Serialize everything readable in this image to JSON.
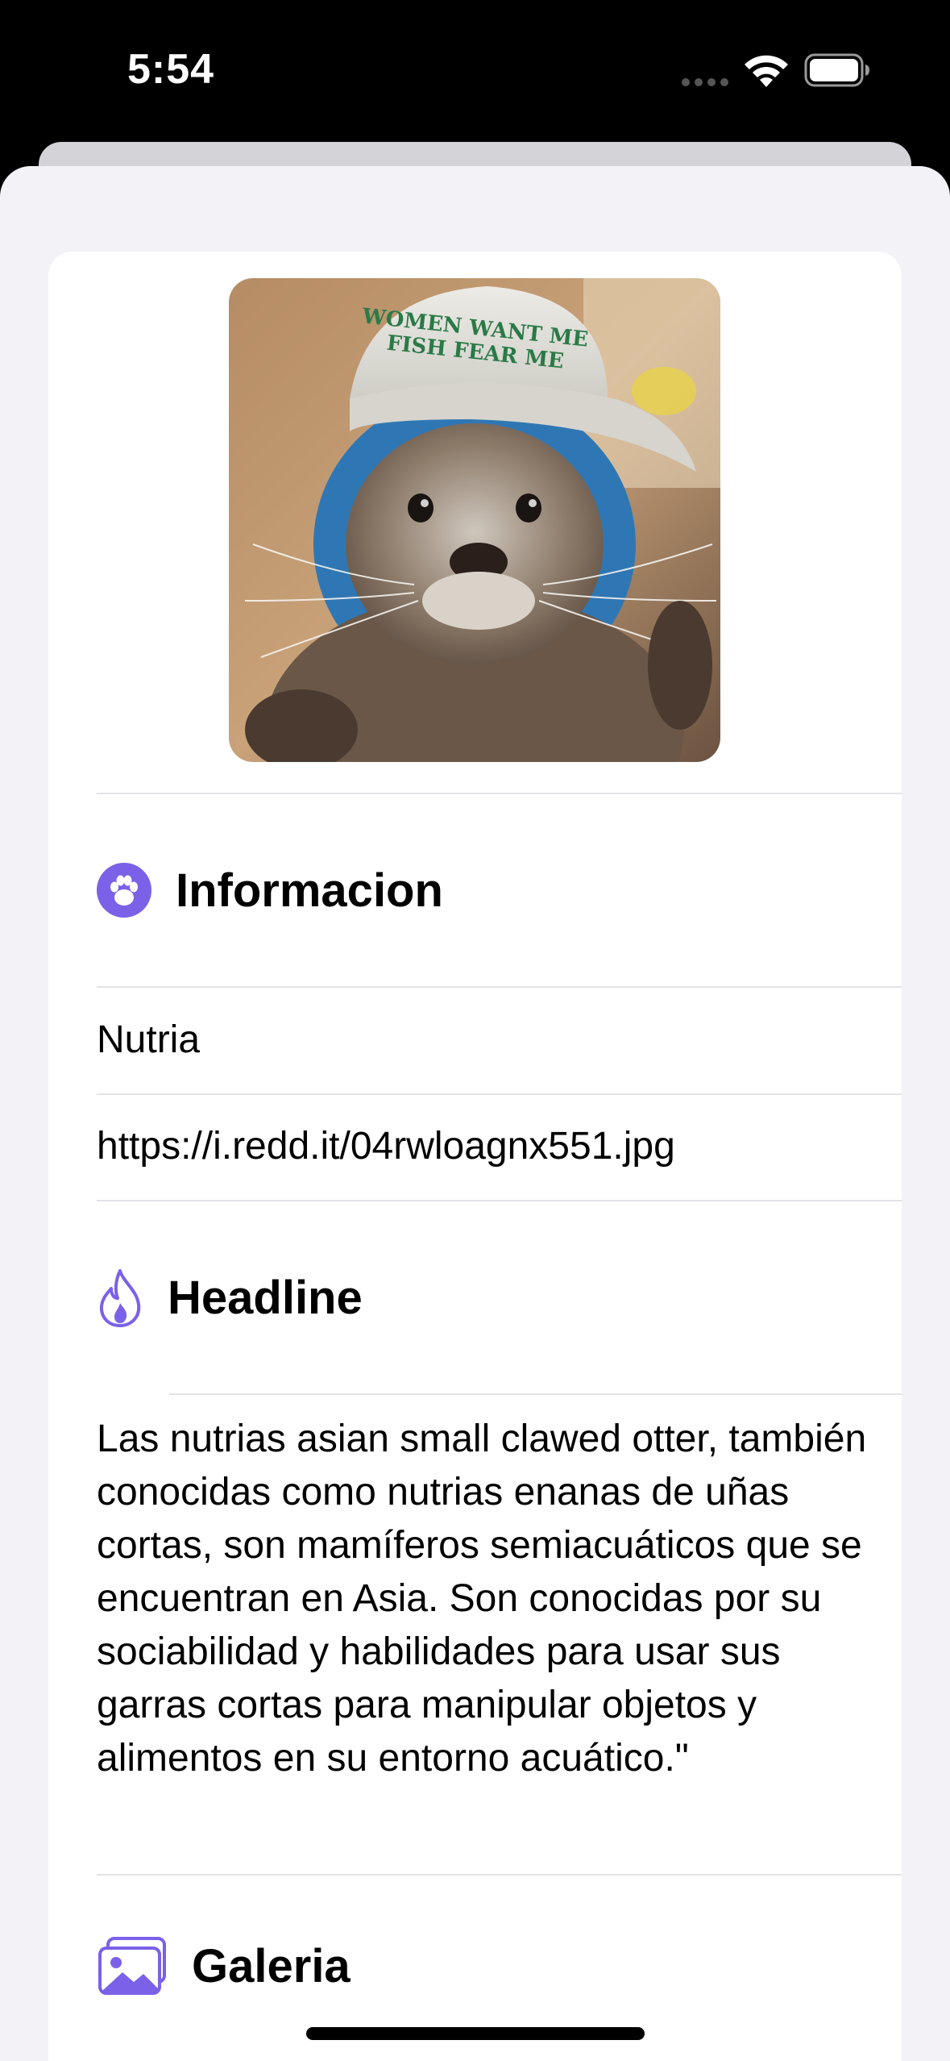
{
  "status_bar": {
    "time": "5:54"
  },
  "profile": {
    "image_alt": "Otter wearing a cap",
    "cap_text_line1": "WOMEN WANT ME",
    "cap_text_line2": "FISH FEAR ME"
  },
  "sections": {
    "informacion": {
      "title": "Informacion",
      "icon": "paw-icon",
      "name": "Nutria",
      "url": "https://i.redd.it/04rwloagnx551.jpg"
    },
    "headline": {
      "title": "Headline",
      "icon": "flame-icon",
      "text": "Las nutrias asian small clawed otter, también conocidas como nutrias enanas de uñas cortas, son mamíferos semiacuáticos que se encuentran en Asia. Son conocidas por su sociabilidad y habilidades para usar sus garras cortas para manipular objetos y alimentos en su entorno acuático.\""
    },
    "galeria": {
      "title": "Galeria",
      "icon": "photos-icon"
    }
  },
  "colors": {
    "accent": "#7b61e8",
    "sheet_background": "#f2f2f7",
    "card_background": "#ffffff",
    "separator": "#e3e3e8"
  }
}
